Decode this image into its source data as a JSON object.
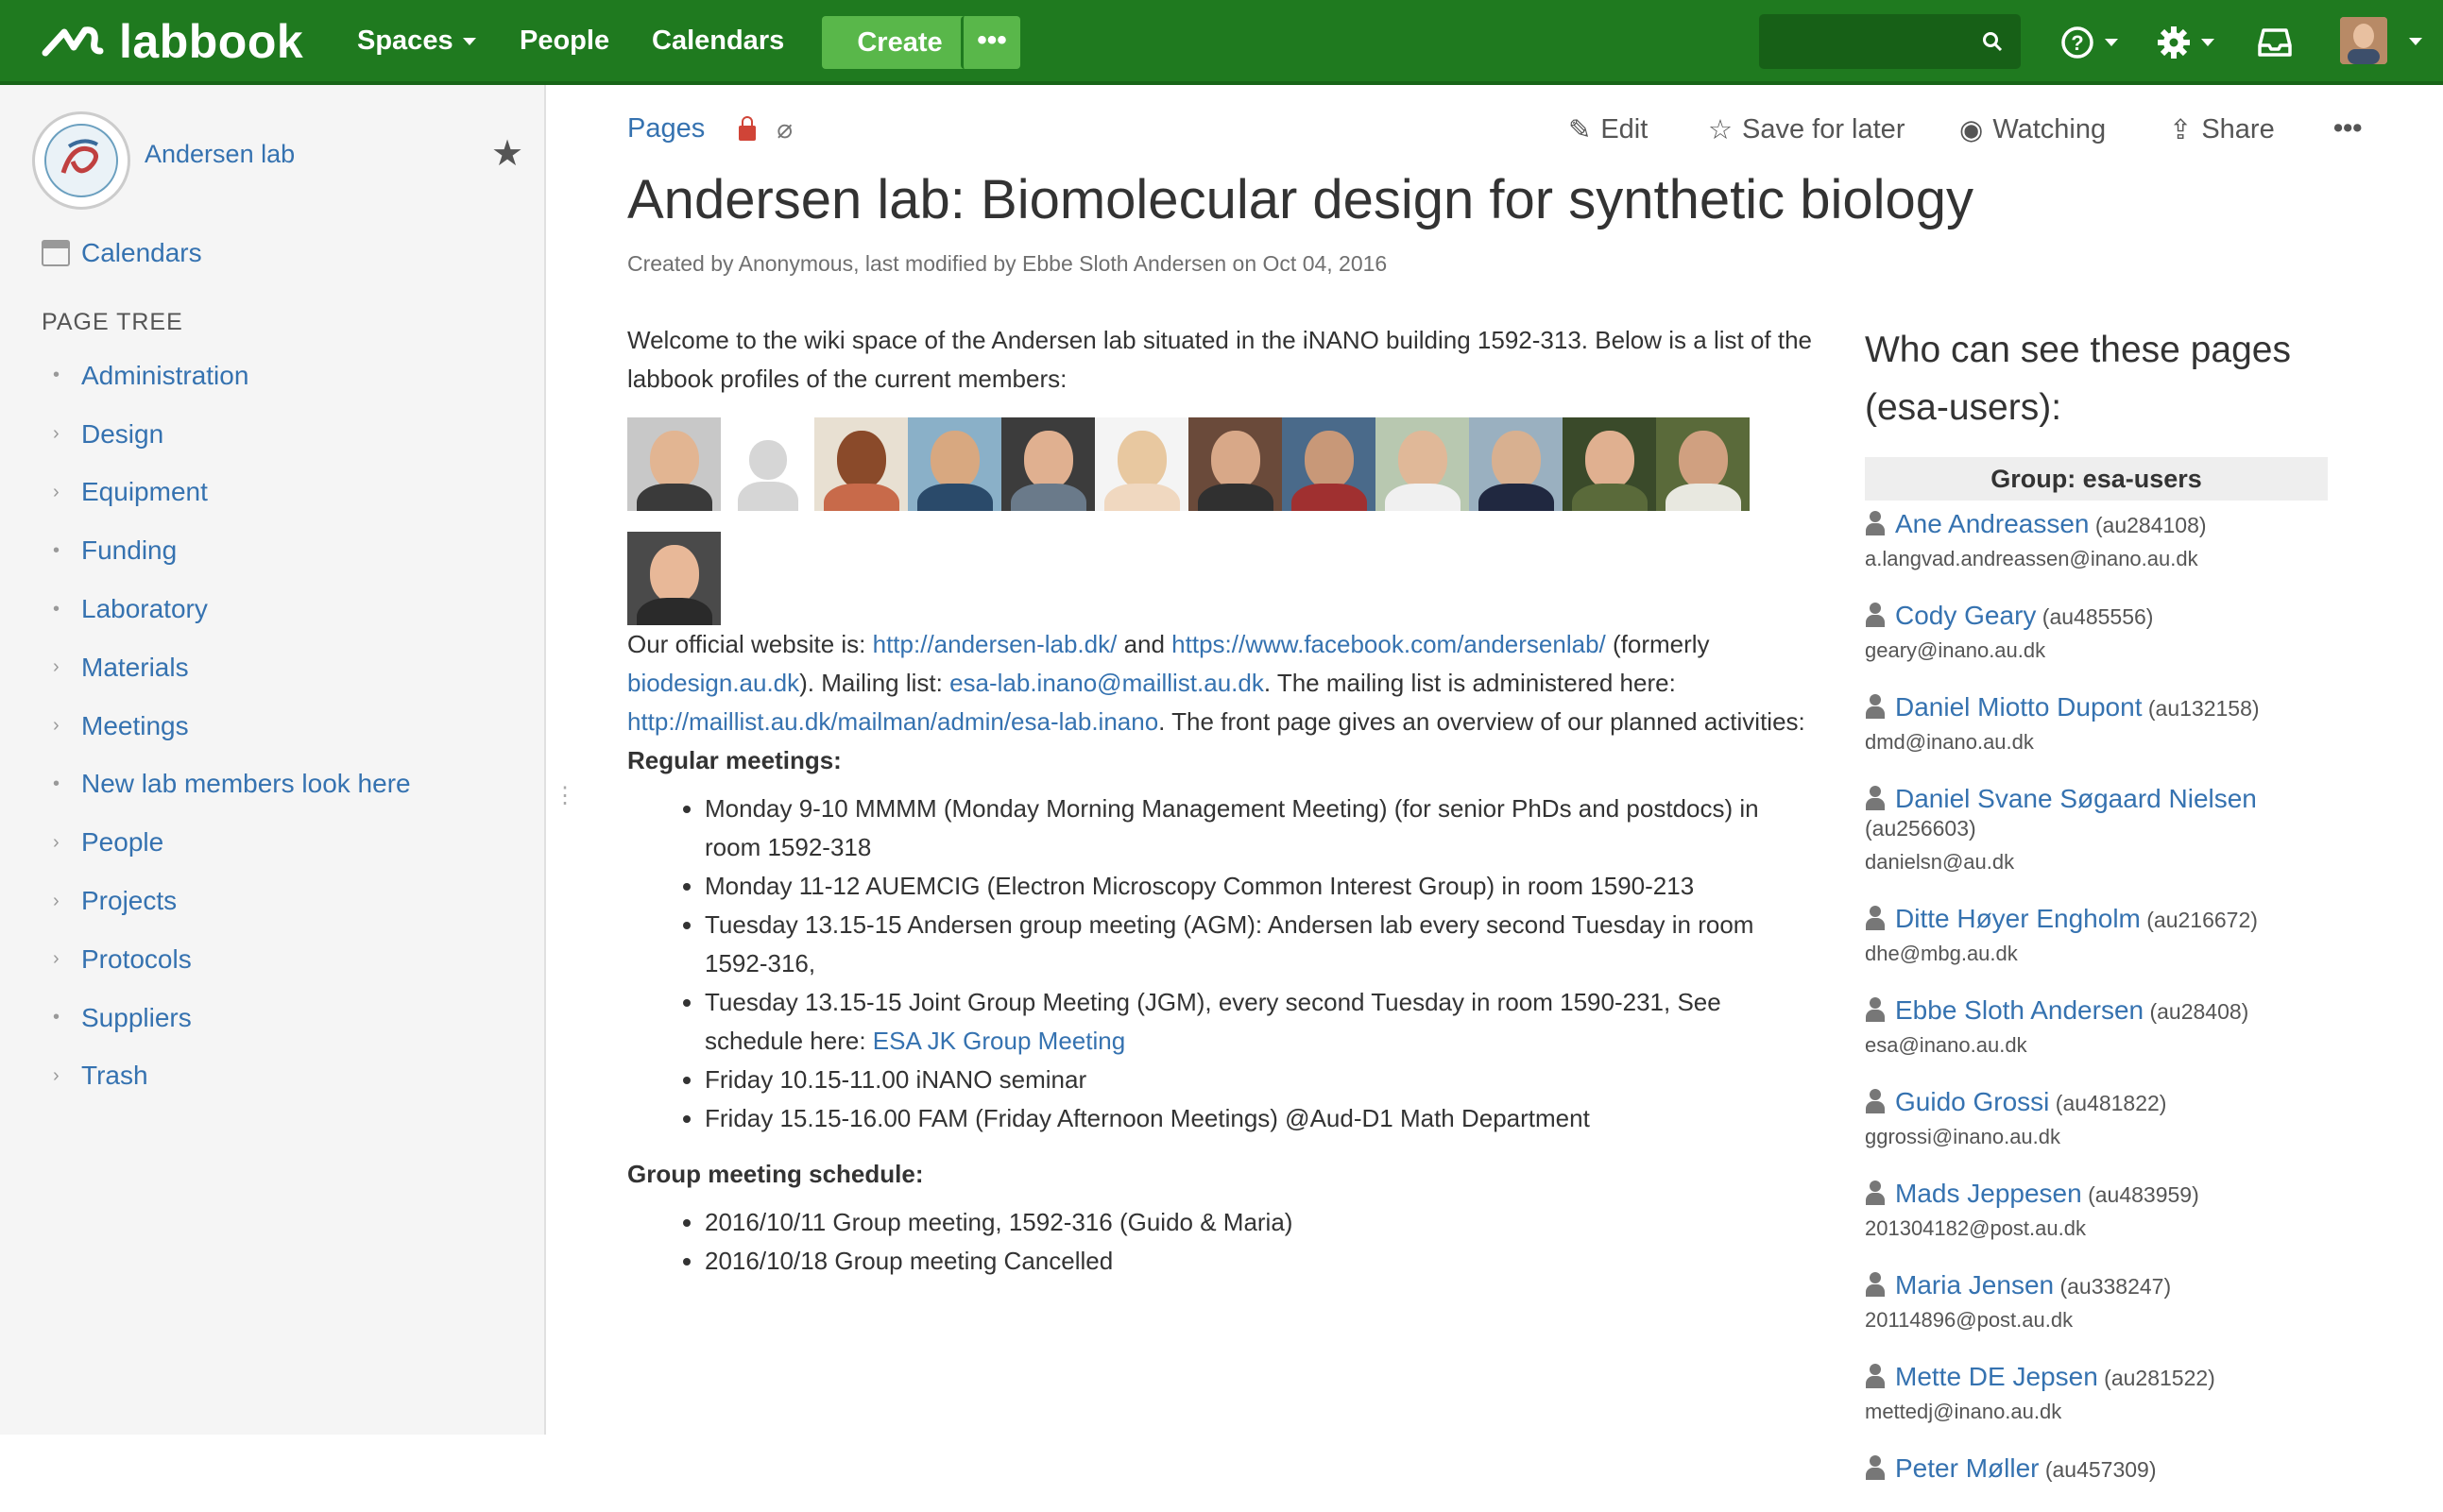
{
  "topbar": {
    "logo_text": "labbook",
    "nav": [
      "Spaces",
      "People",
      "Calendars"
    ],
    "create_label": "Create",
    "more_label": "•••",
    "search_placeholder": ""
  },
  "sidebar": {
    "space_name": "Andersen lab",
    "calendars_label": "Calendars",
    "tree_title": "PAGE TREE",
    "items": [
      {
        "label": "Administration",
        "bullet": "•"
      },
      {
        "label": "Design",
        "bullet": "›"
      },
      {
        "label": "Equipment",
        "bullet": "›"
      },
      {
        "label": "Funding",
        "bullet": "•"
      },
      {
        "label": "Laboratory",
        "bullet": "•"
      },
      {
        "label": "Materials",
        "bullet": "›"
      },
      {
        "label": "Meetings",
        "bullet": "›"
      },
      {
        "label": "New lab members look here",
        "bullet": "•"
      },
      {
        "label": "People",
        "bullet": "›"
      },
      {
        "label": "Projects",
        "bullet": "›"
      },
      {
        "label": "Protocols",
        "bullet": "›"
      },
      {
        "label": "Suppliers",
        "bullet": "•"
      },
      {
        "label": "Trash",
        "bullet": "›"
      }
    ]
  },
  "page": {
    "breadcrumb": "Pages",
    "actions": {
      "edit": "Edit",
      "save": "Save for later",
      "watch": "Watching",
      "share": "Share",
      "more": "•••"
    },
    "title": "Andersen lab: Biomolecular design for synthetic biology",
    "byline": "Created by Anonymous, last modified by Ebbe Sloth Andersen on Oct 04, 2016",
    "welcome": "Welcome to the wiki space of the Andersen lab situated in the iNANO building 1592-313. Below is a list of the labbook profiles of the current members:",
    "website": {
      "t1": "Our official website is: ",
      "l1": "http://andersen-lab.dk/",
      "t2": " and ",
      "l2": "https://www.facebook.com/andersenlab/",
      "t3": " (formerly ",
      "l3": "biodesign.au.dk",
      "t4": "). Mailing list: ",
      "l4": "esa-lab.inano@maillist.au.dk",
      "t5": ". The mailing list is administered here: ",
      "l5": "http://maillist.au.dk/mailman/admin/esa-lab.inano",
      "t6": ". The front page gives an overview of our planned activities:"
    },
    "regular_title": "Regular meetings:",
    "regular": [
      "Monday 9-10 MMMM (Monday Morning Management Meeting) (for senior PhDs and postdocs) in room 1592-318",
      "Monday 11-12 AUEMCIG (Electron Microscopy Common Interest Group) in room 1590-213",
      "Tuesday 13.15-15 Andersen group meeting (AGM): Andersen lab every second Tuesday in room 1592-316,",
      "Tuesday 13.15-15 Joint Group Meeting (JGM), every second Tuesday in room 1590-231, See schedule here: ",
      "Friday 10.15-11.00 iNANO seminar",
      "Friday 15.15-16.00 FAM (Friday Afternoon Meetings) @Aud-D1 Math Department"
    ],
    "jgm_link": "ESA JK Group Meeting",
    "schedule_title": "Group meeting schedule:",
    "schedule": [
      "2016/10/11 Group meeting, 1592-316 (Guido & Maria)",
      "2016/10/18 Group meeting Cancelled"
    ]
  },
  "right": {
    "heading": "Who can see these pages (esa-users):",
    "group_label": "Group: esa-users",
    "members": [
      {
        "name": "Ane Andreassen",
        "id": "(au284108)",
        "email": "a.langvad.andreassen@inano.au.dk"
      },
      {
        "name": "Cody Geary",
        "id": "(au485556)",
        "email": "geary@inano.au.dk"
      },
      {
        "name": "Daniel Miotto Dupont",
        "id": "(au132158)",
        "email": "dmd@inano.au.dk"
      },
      {
        "name": "Daniel Svane Søgaard Nielsen",
        "id": "(au256603)",
        "email": "danielsn@au.dk"
      },
      {
        "name": "Ditte Høyer Engholm",
        "id": "(au216672)",
        "email": "dhe@mbg.au.dk"
      },
      {
        "name": "Ebbe Sloth Andersen",
        "id": "(au28408)",
        "email": "esa@inano.au.dk"
      },
      {
        "name": "Guido Grossi",
        "id": "(au481822)",
        "email": "ggrossi@inano.au.dk"
      },
      {
        "name": "Mads Jeppesen",
        "id": "(au483959)",
        "email": "201304182@post.au.dk"
      },
      {
        "name": "Maria Jensen",
        "id": "(au338247)",
        "email": "20114896@post.au.dk"
      },
      {
        "name": "Mette DE Jepsen",
        "id": "(au281522)",
        "email": "mettedj@inano.au.dk"
      },
      {
        "name": "Peter Møller",
        "id": "(au457309)",
        "email": ""
      }
    ]
  },
  "colors": {
    "brand": "#1f7a1f",
    "create": "#59b74a",
    "link": "#3572b0"
  }
}
